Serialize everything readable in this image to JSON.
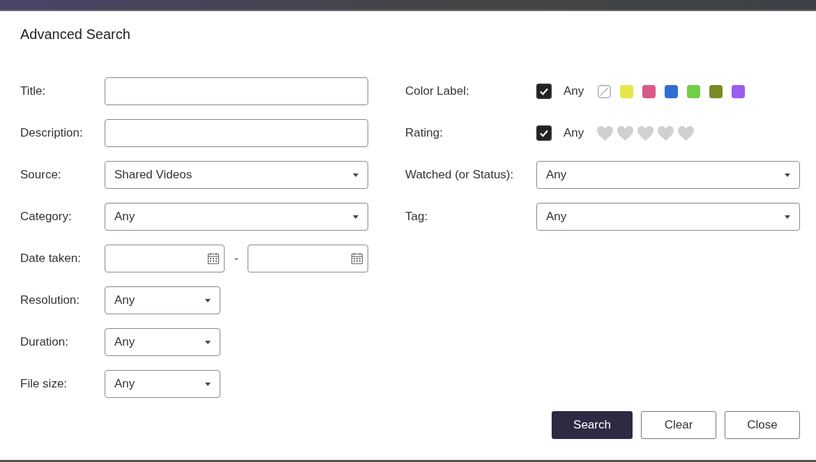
{
  "dialog": {
    "title": "Advanced Search"
  },
  "left_fields": [
    {
      "kind": "text",
      "label": "Title:"
    },
    {
      "kind": "text",
      "label": "Description:"
    },
    {
      "kind": "select",
      "label": "Source:",
      "value": "Shared Videos"
    },
    {
      "kind": "select",
      "label": "Category:",
      "value": "Any"
    },
    {
      "kind": "date_range",
      "label": "Date taken:",
      "separator": "-"
    },
    {
      "kind": "select_small",
      "label": "Resolution:",
      "value": "Any"
    },
    {
      "kind": "select_small",
      "label": "Duration:",
      "value": "Any"
    },
    {
      "kind": "select_small",
      "label": "File size:",
      "value": "Any"
    }
  ],
  "color_label": {
    "label": "Color Label:",
    "any_checked": true,
    "any_label": "Any",
    "swatches": [
      {
        "kind": "none"
      },
      {
        "kind": "color",
        "color": "#e6e64a"
      },
      {
        "kind": "color",
        "color": "#d9598a"
      },
      {
        "kind": "color",
        "color": "#2f6fcf"
      },
      {
        "kind": "color",
        "color": "#74cc4a"
      },
      {
        "kind": "color",
        "color": "#7a8a24"
      },
      {
        "kind": "color",
        "color": "#9b5cf0"
      }
    ]
  },
  "rating": {
    "label": "Rating:",
    "any_checked": true,
    "any_label": "Any",
    "stars": 0
  },
  "right_selects": [
    {
      "label": "Watched (or Status):",
      "value": "Any"
    },
    {
      "label": "Tag:",
      "value": "Any"
    }
  ],
  "buttons": [
    {
      "label": "Search",
      "primary": true
    },
    {
      "label": "Clear",
      "primary": false
    },
    {
      "label": "Close",
      "primary": false
    }
  ]
}
